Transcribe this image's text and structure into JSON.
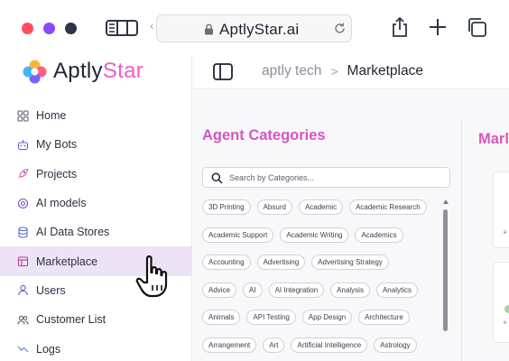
{
  "browser": {
    "url": "AptlyStar.ai",
    "traffic_light_colors": [
      "#ff4d5e",
      "#8a4bff",
      "#2e3446"
    ]
  },
  "brand": {
    "name_part1": "Aptly",
    "name_part2": "Star",
    "accent_color": "#ea5fc8"
  },
  "sidebar": {
    "active_item": "Marketplace",
    "items": [
      {
        "label": "Home",
        "icon": "grid-icon"
      },
      {
        "label": "My Bots",
        "icon": "bot-icon"
      },
      {
        "label": "Projects",
        "icon": "rocket-icon"
      },
      {
        "label": "AI models",
        "icon": "model-icon"
      },
      {
        "label": "AI Data Stores",
        "icon": "database-icon"
      },
      {
        "label": "Marketplace",
        "icon": "marketplace-icon"
      },
      {
        "label": "Users",
        "icon": "user-icon"
      },
      {
        "label": "Customer List",
        "icon": "users-icon"
      },
      {
        "label": "Logs",
        "icon": "logs-icon"
      }
    ]
  },
  "header": {
    "breadcrumb_root": "aptly tech",
    "breadcrumb_separator": ">",
    "breadcrumb_current": "Marketplace"
  },
  "categories": {
    "title": "Agent Categories",
    "search_placeholder": "Search by Categories...",
    "title_color": "#d656bf",
    "tag_rows": [
      [
        "3D Printing",
        "Absurd",
        "Academic",
        "Academic Research"
      ],
      [
        "Academic Support",
        "Academic Writing",
        "Academics"
      ],
      [
        "Accounting",
        "Advertising",
        "Advertising Strategy"
      ],
      [
        "Advice",
        "AI",
        "AI Integration",
        "Analysis",
        "Analytics"
      ],
      [
        "Animals",
        "API Testing",
        "App Design",
        "Architecture"
      ],
      [
        "Arrangement",
        "Art",
        "Artificial Intelligence",
        "Astrology"
      ]
    ]
  },
  "marketplace": {
    "title": "Marl",
    "card_snippet_1": "e",
    "card_snippet_2": "e"
  }
}
